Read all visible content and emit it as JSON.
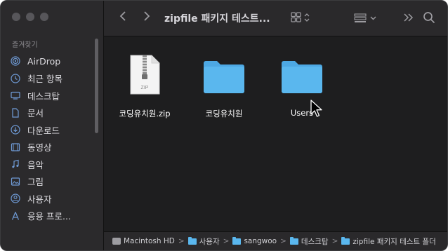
{
  "toolbar": {
    "title": "zipfile 패키지 테스트...",
    "back_icon": "chevron-left-icon",
    "forward_icon": "chevron-right-icon",
    "view_icon": "grid-icon",
    "group_icon": "group-by-icon",
    "more_icon": "double-chevron-icon",
    "search_icon": "search-icon"
  },
  "sidebar": {
    "section_label": "즐겨찾기",
    "items": [
      {
        "label": "AirDrop",
        "icon": "airdrop-icon"
      },
      {
        "label": "최근 항목",
        "icon": "clock-icon"
      },
      {
        "label": "데스크탑",
        "icon": "desktop-icon"
      },
      {
        "label": "문서",
        "icon": "document-icon"
      },
      {
        "label": "다운로드",
        "icon": "download-icon"
      },
      {
        "label": "동영상",
        "icon": "film-icon"
      },
      {
        "label": "음악",
        "icon": "music-icon"
      },
      {
        "label": "그림",
        "icon": "photo-icon"
      },
      {
        "label": "사용자",
        "icon": "user-icon"
      },
      {
        "label": "응용 프로...",
        "icon": "applications-icon"
      }
    ]
  },
  "files": [
    {
      "name": "코딩유치원.zip",
      "type": "zip",
      "zip_badge": "ZIP"
    },
    {
      "name": "코딩유치원",
      "type": "folder"
    },
    {
      "name": "Users",
      "type": "folder"
    }
  ],
  "pathbar": {
    "crumbs": [
      "Macintosh HD",
      "사용자",
      "sangwoo",
      "데스크탑",
      "zipfile 패키지 테스트 폴더"
    ],
    "separator": ">"
  },
  "colors": {
    "folder": "#5ab7ee",
    "background": "#1e1e1f",
    "sidebar": "#2b2a2c"
  }
}
